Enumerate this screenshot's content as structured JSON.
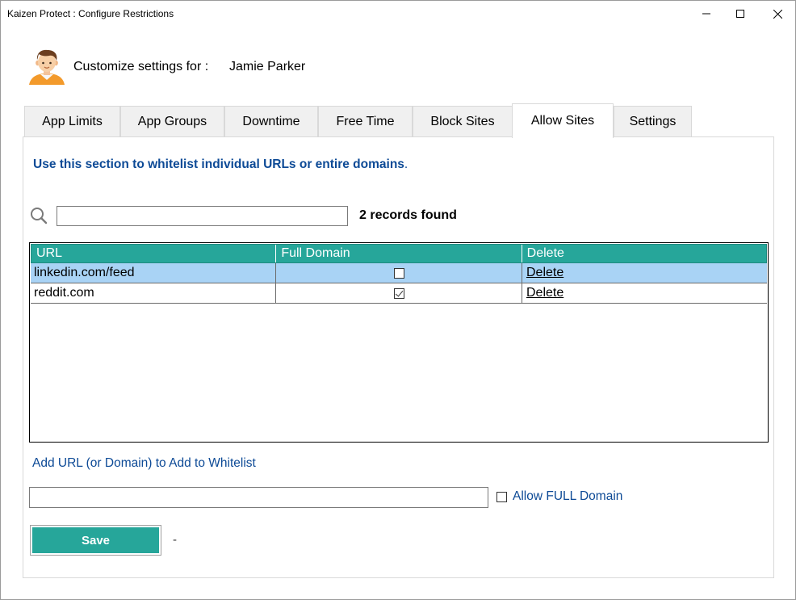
{
  "window": {
    "title": "Kaizen Protect : Configure Restrictions",
    "minimize": "—",
    "maximize": "☐",
    "close": "✕"
  },
  "header": {
    "customize_label": "Customize settings for :",
    "user_name": "Jamie Parker",
    "avatar_icon": "person-avatar-icon"
  },
  "tabs": [
    {
      "label": "App Limits",
      "active": false
    },
    {
      "label": "App Groups",
      "active": false
    },
    {
      "label": "Downtime",
      "active": false
    },
    {
      "label": "Free Time",
      "active": false
    },
    {
      "label": "Block Sites",
      "active": false
    },
    {
      "label": "Allow Sites",
      "active": true
    },
    {
      "label": "Settings",
      "active": false
    }
  ],
  "allow_sites": {
    "intro_text": "Use this section to whitelist individual URLs or entire domains",
    "intro_period": ".",
    "search": {
      "value": "",
      "placeholder": ""
    },
    "records_found": "2 records found",
    "grid": {
      "columns": [
        "URL",
        "Full Domain",
        "Delete"
      ],
      "rows": [
        {
          "url": "linkedin.com/feed",
          "full_domain": false,
          "delete": "Delete",
          "selected": true
        },
        {
          "url": "reddit.com",
          "full_domain": true,
          "delete": "Delete",
          "selected": false
        }
      ]
    },
    "add_label": "Add URL (or Domain) to Add to Whitelist",
    "add_input": {
      "value": "",
      "placeholder": ""
    },
    "allow_full_domain_label": "Allow FULL Domain",
    "allow_full_domain_checked": false,
    "save_label": "Save",
    "status_text": "-"
  },
  "colors": {
    "accent": "#26a69a",
    "link_blue": "#0d4a96",
    "selection": "#a9d3f5"
  }
}
